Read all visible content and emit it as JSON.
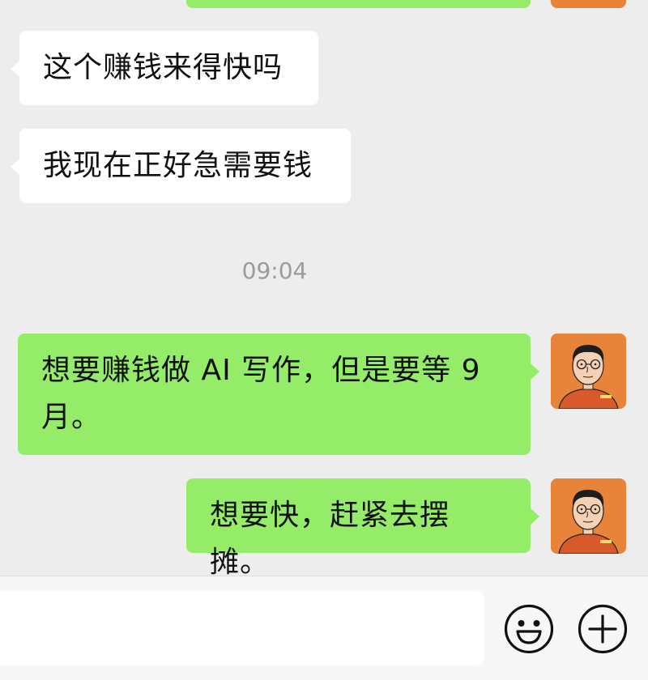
{
  "chat": {
    "messages": [
      {
        "side": "recv",
        "text": "这个赚钱来得快吗"
      },
      {
        "side": "recv",
        "text": "我现在正好急需要钱"
      },
      {
        "side": "sent",
        "text_line1": "想要赚钱做 AI 写作，但是要等 9",
        "text_line2": "月。"
      },
      {
        "side": "sent",
        "text": "想要快，赶紧去摆摊。"
      }
    ],
    "timestamp": "09:04"
  },
  "colors": {
    "background": "#ededed",
    "sent_bubble": "#95ec69",
    "recv_bubble": "#ffffff",
    "avatar_bg": "#e8833a",
    "input_bar": "#f7f7f7"
  },
  "icons": {
    "emoji": "emoji-smile-icon",
    "more": "plus-circle-icon"
  }
}
